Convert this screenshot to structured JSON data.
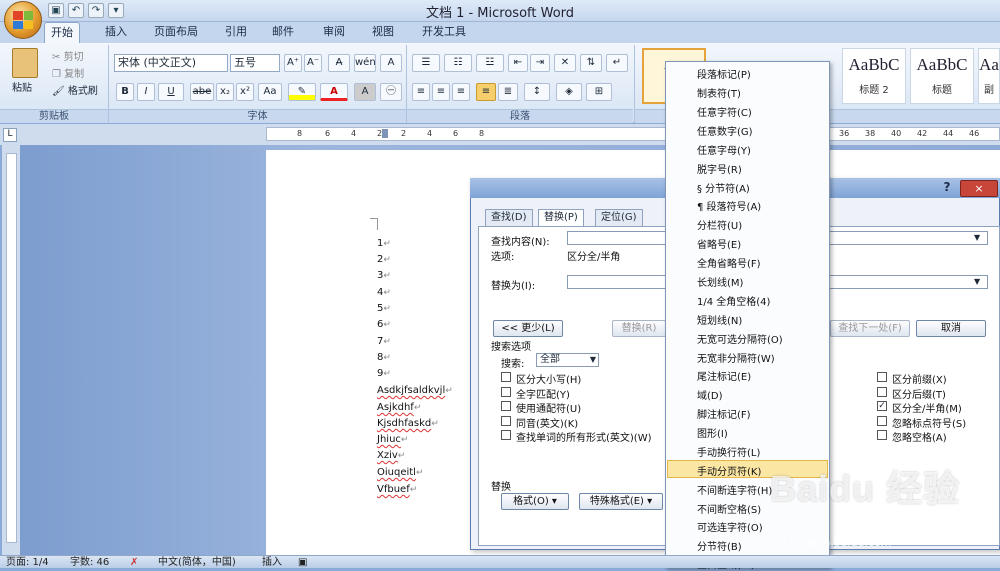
{
  "window": {
    "title": "文档 1 - Microsoft Word"
  },
  "tabs": [
    "开始",
    "插入",
    "页面布局",
    "引用",
    "邮件",
    "审阅",
    "视图",
    "开发工具"
  ],
  "clipboard": {
    "paste": "粘贴",
    "cut": "剪切",
    "copy": "复制",
    "format_painter": "格式刷",
    "group": "剪贴板"
  },
  "font": {
    "name": "宋体 (中文正文)",
    "size": "五号",
    "group": "字体",
    "bold": "B",
    "italic": "I",
    "underline": "U",
    "strike": "abe",
    "sub": "x₂",
    "sup": "x²",
    "case": "Aa",
    "grow": "A⁺",
    "shrink": "A⁻"
  },
  "paragraph": {
    "group": "段落"
  },
  "styles": {
    "group": "样式",
    "cards": [
      {
        "sample": "AaBbC",
        "name": "标题 2"
      },
      {
        "sample": "AaBbC",
        "name": "标题"
      },
      {
        "sample": "Aa",
        "name": "副"
      }
    ]
  },
  "ruler": {
    "ticks": [
      "8",
      "6",
      "4",
      "2",
      "2",
      "4",
      "6",
      "8",
      "36",
      "38",
      "40",
      "42",
      "44",
      "46"
    ]
  },
  "document": {
    "lines": [
      "1",
      "2",
      "3",
      "4",
      "5",
      "6",
      "7",
      "8",
      "9",
      "Asdkjfsaldkvjl",
      "Asjkdhf",
      "Kjsdhfaskd",
      "Jhiuc",
      "Xziv",
      "Oiuqeitl",
      "Vfbuef"
    ],
    "para_mark": "↵"
  },
  "dialog": {
    "help": "?",
    "close": "×",
    "tabs": [
      "查找(D)",
      "替换(P)",
      "定位(G)"
    ],
    "find_label": "查找内容(N):",
    "options_label": "选项:",
    "options_value": "区分全/半角",
    "replace_label": "替换为(I):",
    "less_button": "<< 更少(L)",
    "replace_button": "替换(R)",
    "find_next": "查找下一处(F)",
    "cancel": "取消",
    "search_options": "搜索选项",
    "search_label": "搜索:",
    "search_value": "全部",
    "left_checks": [
      {
        "label": "区分大小写(H)",
        "checked": false
      },
      {
        "label": "全字匹配(Y)",
        "checked": false
      },
      {
        "label": "使用通配符(U)",
        "checked": false
      },
      {
        "label": "同音(英文)(K)",
        "checked": false
      },
      {
        "label": "查找单词的所有形式(英文)(W)",
        "checked": false
      }
    ],
    "right_checks": [
      {
        "label": "区分前缀(X)",
        "checked": false
      },
      {
        "label": "区分后缀(T)",
        "checked": false
      },
      {
        "label": "区分全/半角(M)",
        "checked": true
      },
      {
        "label": "忽略标点符号(S)",
        "checked": false
      },
      {
        "label": "忽略空格(A)",
        "checked": false
      }
    ],
    "replace_section": "替换",
    "format_button": "格式(O) ▾",
    "special_button": "特殊格式(E) ▾"
  },
  "special_menu": {
    "items": [
      "段落标记(P)",
      "制表符(T)",
      "任意字符(C)",
      "任意数字(G)",
      "任意字母(Y)",
      "脱字号(R)",
      "§ 分节符(A)",
      "¶ 段落符号(A)",
      "分栏符(U)",
      "省略号(E)",
      "全角省略号(F)",
      "长划线(M)",
      "1/4 全角空格(4)",
      "短划线(N)",
      "无宽可选分隔符(O)",
      "无宽非分隔符(W)",
      "尾注标记(E)",
      "域(D)",
      "脚注标记(F)",
      "图形(I)",
      "手动换行符(L)",
      "手动分页符(K)",
      "不间断连字符(H)",
      "不间断空格(S)",
      "可选连字符(O)",
      "分节符(B)",
      "空白区域(W)"
    ],
    "highlighted": "手动分页符(K)"
  },
  "status": {
    "page": "页面: 1/4",
    "words": "字数: 46",
    "lang": "中文(简体，中国)",
    "mode": "插入"
  },
  "watermark": {
    "brand": "Baidu 经验",
    "url": "jingyan.baidu.com"
  }
}
